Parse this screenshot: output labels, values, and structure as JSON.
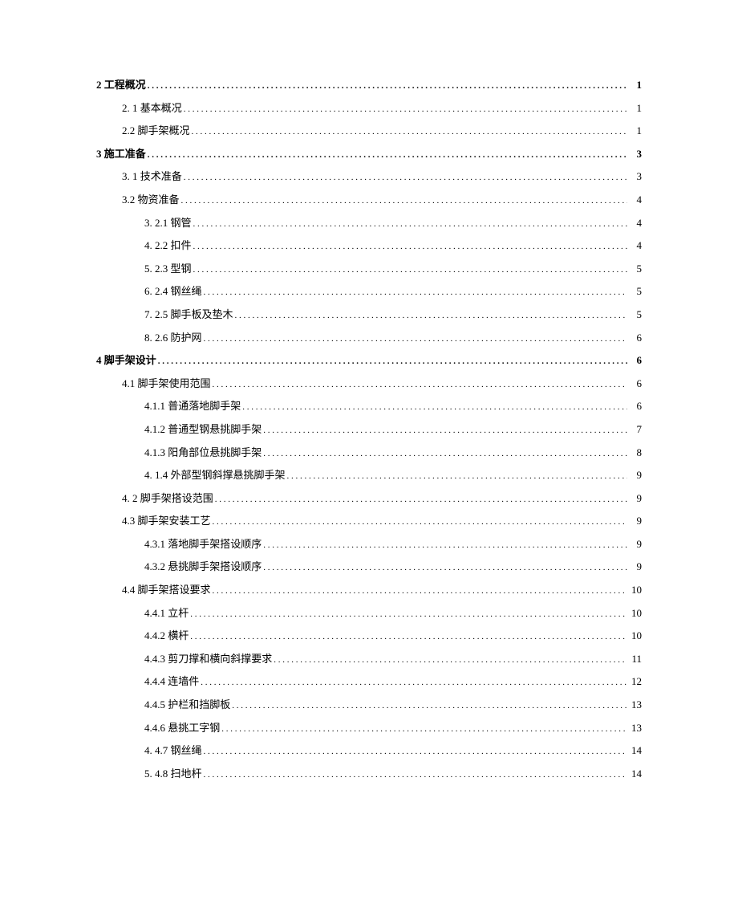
{
  "toc": [
    {
      "level": 0,
      "bold": true,
      "label": "2 工程概况",
      "page": "1"
    },
    {
      "level": 1,
      "bold": false,
      "label": "2.  1 基本概况",
      "page": "1"
    },
    {
      "level": 1,
      "bold": false,
      "label": "2.2 脚手架概况",
      "page": "1"
    },
    {
      "level": 0,
      "bold": true,
      "label": "3 施工准备",
      "page": "3"
    },
    {
      "level": 1,
      "bold": false,
      "label": "3.  1 技术准备",
      "page": "3"
    },
    {
      "level": 1,
      "bold": false,
      "label": "3.2 物资准备",
      "page": "4"
    },
    {
      "level": 2,
      "bold": false,
      "label": "3.  2.1 钢管",
      "page": "4"
    },
    {
      "level": 2,
      "bold": false,
      "label": "4.  2.2 扣件",
      "page": "4"
    },
    {
      "level": 2,
      "bold": false,
      "label": "5.  2.3 型钢",
      "page": "5"
    },
    {
      "level": 2,
      "bold": false,
      "label": "6.  2.4 钢丝绳",
      "page": "5"
    },
    {
      "level": 2,
      "bold": false,
      "label": "7.  2.5 脚手板及垫木",
      "page": "5"
    },
    {
      "level": 2,
      "bold": false,
      "label": "8.  2.6 防护网",
      "page": "6"
    },
    {
      "level": 0,
      "bold": true,
      "label": "4 脚手架设计",
      "page": "6"
    },
    {
      "level": 1,
      "bold": false,
      "label": "4.1 脚手架使用范围",
      "page": "6"
    },
    {
      "level": 2,
      "bold": false,
      "label": "4.1.1 普通落地脚手架",
      "page": "6"
    },
    {
      "level": 2,
      "bold": false,
      "label": "4.1.2 普通型钢悬挑脚手架",
      "page": "7"
    },
    {
      "level": 2,
      "bold": false,
      "label": "4.1.3 阳角部位悬挑脚手架",
      "page": "8"
    },
    {
      "level": 2,
      "bold": false,
      "label": "4.  1.4 外部型钢斜撑悬挑脚手架",
      "page": "9"
    },
    {
      "level": 1,
      "bold": false,
      "label": "4.  2 脚手架搭设范围",
      "page": "9"
    },
    {
      "level": 1,
      "bold": false,
      "label": "4.3 脚手架安装工艺",
      "page": "9"
    },
    {
      "level": 2,
      "bold": false,
      "label": "4.3.1 落地脚手架搭设顺序",
      "page": "9"
    },
    {
      "level": 2,
      "bold": false,
      "label": "4.3.2 悬挑脚手架搭设顺序",
      "page": "9"
    },
    {
      "level": 1,
      "bold": false,
      "label": "4.4 脚手架搭设要求",
      "page": "10"
    },
    {
      "level": 2,
      "bold": false,
      "label": "4.4.1  立杆",
      "page": "10"
    },
    {
      "level": 2,
      "bold": false,
      "label": "4.4.2  横杆",
      "page": "10"
    },
    {
      "level": 2,
      "bold": false,
      "label": "4.4.3 剪刀撑和横向斜撑要求",
      "page": "11"
    },
    {
      "level": 2,
      "bold": false,
      "label": "4.4.4 连墙件",
      "page": "12"
    },
    {
      "level": 2,
      "bold": false,
      "label": "4.4.5 护栏和挡脚板",
      "page": "13"
    },
    {
      "level": 2,
      "bold": false,
      "label": "4.4.6 悬挑工字钢",
      "page": "13"
    },
    {
      "level": 2,
      "bold": false,
      "label": "4.  4.7 钢丝绳",
      "page": "14"
    },
    {
      "level": 2,
      "bold": false,
      "label": "5.  4.8 扫地杆",
      "page": "14"
    }
  ]
}
